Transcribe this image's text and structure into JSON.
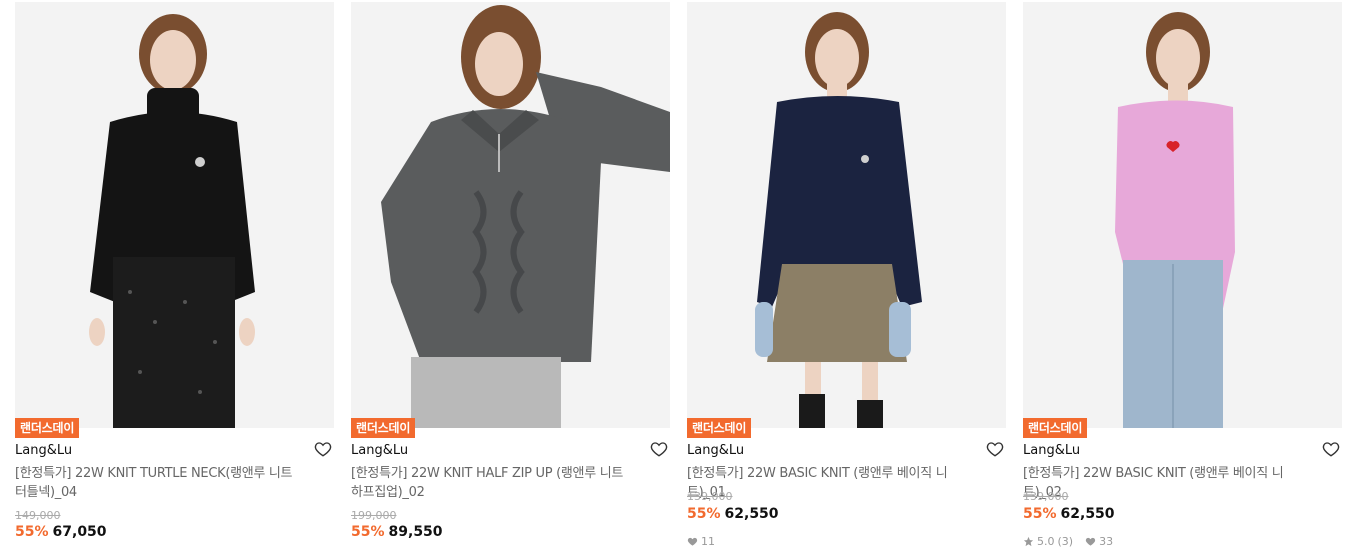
{
  "colors": {
    "accent": "#f26a2e",
    "badge_bg": "#f26a2e",
    "muted": "#999999"
  },
  "products": [
    {
      "badge": "랜더스데이",
      "brand": "Lang&Lu",
      "title_line1": "[한정특가] 22W KNIT TURTLE NECK(랭앤루 니트",
      "title_line2": "터틀넥)_04",
      "original_price": "149,000",
      "discount": "55%",
      "price": "67,050",
      "sweater_color": "#141414",
      "bottom_color": "#1c1c1c",
      "icons": {
        "wishlist": "heart-outline-icon"
      }
    },
    {
      "badge": "랜더스데이",
      "brand": "Lang&Lu",
      "title_line1": "[한정특가] 22W KNIT HALF ZIP UP (랭앤루 니트",
      "title_line2": "하프집업)_02",
      "original_price": "199,000",
      "discount": "55%",
      "price": "89,550",
      "sweater_color": "#5a5c5d",
      "bottom_color": "#b9b9b9",
      "icons": {
        "wishlist": "heart-outline-icon"
      }
    },
    {
      "badge": "랜더스데이",
      "brand": "Lang&Lu",
      "title_line1": "[한정특가] 22W BASIC KNIT (랭앤루 베이직 니트)_01",
      "title_line2": "",
      "original_price": "139,000",
      "discount": "55%",
      "price": "62,550",
      "likes": "11",
      "sweater_color": "#1b2340",
      "bottom_color": "#8c7f66",
      "icons": {
        "wishlist": "heart-outline-icon",
        "likes": "heart-filled-icon"
      }
    },
    {
      "badge": "랜더스데이",
      "brand": "Lang&Lu",
      "title_line1": "[한정특가] 22W BASIC KNIT (랭앤루 베이직 니트)_02",
      "title_line2": "",
      "original_price": "139,000",
      "discount": "55%",
      "price": "62,550",
      "rating": "5.0",
      "reviews": "(3)",
      "likes": "33",
      "sweater_color": "#e7a8d9",
      "bottom_color": "#9fb6cc",
      "icons": {
        "wishlist": "heart-outline-icon",
        "rating": "star-icon",
        "likes": "heart-filled-icon"
      }
    }
  ]
}
